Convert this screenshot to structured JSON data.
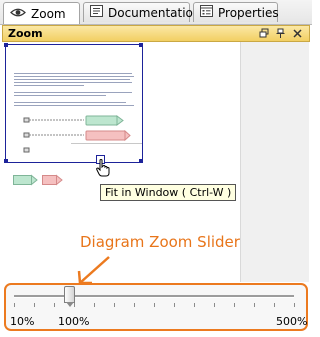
{
  "tabs": [
    {
      "label": "Zoom",
      "icon": "eye-icon",
      "active": true
    },
    {
      "label": "Documentation",
      "icon": "documentation-icon",
      "active": false
    },
    {
      "label": "Properties",
      "icon": "properties-icon",
      "active": false
    }
  ],
  "panel": {
    "title": "Zoom",
    "buttons": [
      "restore-icon",
      "pin-icon",
      "close-icon"
    ]
  },
  "tooltip": {
    "text": "Fit in Window ( Ctrl-W )"
  },
  "callout": {
    "text": "Diagram Zoom Slider"
  },
  "slider": {
    "min_label": "10%",
    "current_label": "100%",
    "max_label": "500%",
    "min": 10,
    "max": 500,
    "value": 100
  },
  "colors": {
    "accent": "#ec7a1f",
    "viewport_frame": "#1d239a",
    "panel_header": "#f2cf63",
    "tooltip_bg": "#ffffe1"
  }
}
